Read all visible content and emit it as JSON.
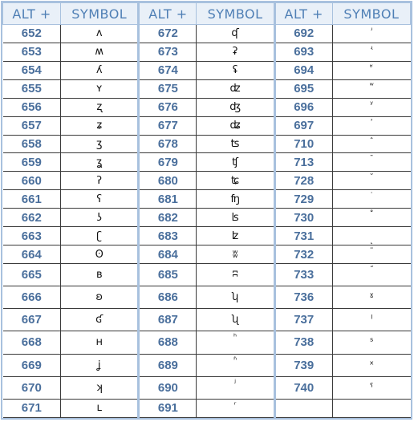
{
  "header": {
    "alt_label": "ALT +",
    "symbol_label": "SYMBOL"
  },
  "columns": [
    {
      "rows": [
        {
          "code": "652",
          "symbol": "ʌ"
        },
        {
          "code": "653",
          "symbol": "ʍ"
        },
        {
          "code": "654",
          "symbol": "ʎ"
        },
        {
          "code": "655",
          "symbol": "ʏ"
        },
        {
          "code": "656",
          "symbol": "ʐ"
        },
        {
          "code": "657",
          "symbol": "ʑ"
        },
        {
          "code": "658",
          "symbol": "ʒ"
        },
        {
          "code": "659",
          "symbol": "ʓ"
        },
        {
          "code": "660",
          "symbol": "ʔ"
        },
        {
          "code": "661",
          "symbol": "ʕ"
        },
        {
          "code": "662",
          "symbol": "ʖ"
        },
        {
          "code": "663",
          "symbol": "ʗ"
        },
        {
          "code": "664",
          "symbol": "ʘ"
        },
        {
          "code": "665",
          "symbol": "ʙ"
        },
        {
          "code": "666",
          "symbol": "ʚ"
        },
        {
          "code": "667",
          "symbol": "ʛ"
        },
        {
          "code": "668",
          "symbol": "ʜ"
        },
        {
          "code": "669",
          "symbol": "ʝ"
        },
        {
          "code": "670",
          "symbol": "ʞ"
        },
        {
          "code": "671",
          "symbol": "ʟ"
        }
      ]
    },
    {
      "rows": [
        {
          "code": "672",
          "symbol": "ʠ"
        },
        {
          "code": "673",
          "symbol": "ʡ"
        },
        {
          "code": "674",
          "symbol": "ʢ"
        },
        {
          "code": "675",
          "symbol": "ʣ"
        },
        {
          "code": "676",
          "symbol": "ʤ"
        },
        {
          "code": "677",
          "symbol": "ʥ"
        },
        {
          "code": "678",
          "symbol": "ʦ"
        },
        {
          "code": "679",
          "symbol": "ʧ"
        },
        {
          "code": "680",
          "symbol": "ʨ"
        },
        {
          "code": "681",
          "symbol": "ʩ"
        },
        {
          "code": "682",
          "symbol": "ʪ"
        },
        {
          "code": "683",
          "symbol": "ʫ"
        },
        {
          "code": "684",
          "symbol": "ʬ"
        },
        {
          "code": "685",
          "symbol": "ʭ"
        },
        {
          "code": "686",
          "symbol": "ʮ"
        },
        {
          "code": "687",
          "symbol": "ʯ"
        },
        {
          "code": "688",
          "symbol": "ʰ"
        },
        {
          "code": "689",
          "symbol": "ʱ"
        },
        {
          "code": "690",
          "symbol": "ʲ"
        },
        {
          "code": "691",
          "symbol": "ʳ"
        }
      ]
    },
    {
      "rows": [
        {
          "code": "692",
          "symbol": "ʴ"
        },
        {
          "code": "693",
          "symbol": "ʵ"
        },
        {
          "code": "694",
          "symbol": "ʶ"
        },
        {
          "code": "695",
          "symbol": "ʷ"
        },
        {
          "code": "696",
          "symbol": "ʸ"
        },
        {
          "code": "697",
          "symbol": "ʹ"
        },
        {
          "code": "710",
          "symbol": "ˆ"
        },
        {
          "code": "713",
          "symbol": "ˉ"
        },
        {
          "code": "728",
          "symbol": "˘"
        },
        {
          "code": "729",
          "symbol": "˙"
        },
        {
          "code": "730",
          "symbol": "˚"
        },
        {
          "code": "731",
          "symbol": "˛"
        },
        {
          "code": "732",
          "symbol": "˜"
        },
        {
          "code": "733",
          "symbol": "˝"
        },
        {
          "code": "736",
          "symbol": "ˠ"
        },
        {
          "code": "737",
          "symbol": "ˡ"
        },
        {
          "code": "738",
          "symbol": "ˢ"
        },
        {
          "code": "739",
          "symbol": "ˣ"
        },
        {
          "code": "740",
          "symbol": "ˤ"
        },
        {
          "code": "",
          "symbol": ""
        }
      ]
    }
  ]
}
